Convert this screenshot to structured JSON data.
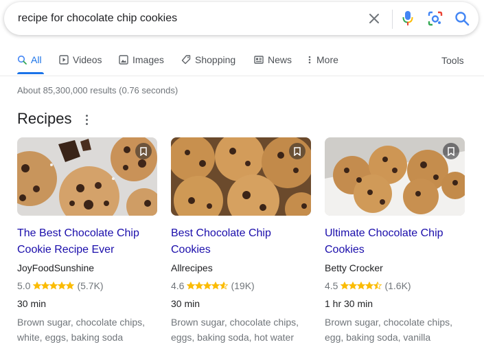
{
  "search": {
    "query": "recipe for chocolate chip cookies"
  },
  "tabs": [
    {
      "label": "All",
      "icon": "search-icon",
      "active": true
    },
    {
      "label": "Videos",
      "icon": "video-icon"
    },
    {
      "label": "Images",
      "icon": "image-icon"
    },
    {
      "label": "Shopping",
      "icon": "tag-icon"
    },
    {
      "label": "News",
      "icon": "news-icon"
    },
    {
      "label": "More",
      "icon": "more-vert-icon"
    }
  ],
  "tools_label": "Tools",
  "result_stats": "About 85,300,000 results (0.76 seconds)",
  "recipes": {
    "title": "Recipes",
    "items": [
      {
        "title": "The Best Chocolate Chip Cookie Recipe Ever",
        "source": "JoyFoodSunshine",
        "rating": "5.0",
        "rating_value": 5.0,
        "review_count": "(5.7K)",
        "time": "30 min",
        "ingredients": "Brown sugar, chocolate chips, white, eggs, baking soda"
      },
      {
        "title": "Best Chocolate Chip Cookies",
        "source": "Allrecipes",
        "rating": "4.6",
        "rating_value": 4.6,
        "review_count": "(19K)",
        "time": "30 min",
        "ingredients": "Brown sugar, chocolate chips, eggs, baking soda, hot water"
      },
      {
        "title": "Ultimate Chocolate Chip Cookies",
        "source": "Betty Crocker",
        "rating": "4.5",
        "rating_value": 4.5,
        "review_count": "(1.6K)",
        "time": "1 hr 30 min",
        "ingredients": "Brown sugar, chocolate chips, egg, baking soda, vanilla"
      }
    ]
  },
  "colors": {
    "link": "#1a0dab",
    "accent": "#1a73e8",
    "star": "#fbbc04"
  }
}
